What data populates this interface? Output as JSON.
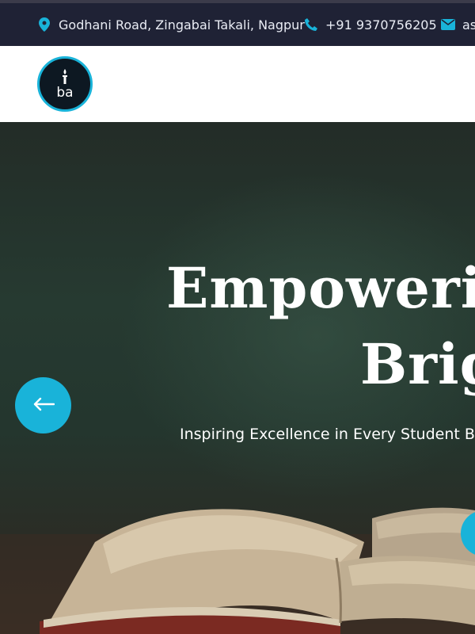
{
  "topbar": {
    "address": "Godhani Road, Zingabai Takali, Nagpur",
    "phone": "+91 9370756205",
    "email_partial": "as",
    "icons": {
      "address": "map-marker-icon",
      "phone": "phone-icon",
      "email": "envelope-icon"
    }
  },
  "header": {
    "logo_text": "ba",
    "logo_icon": "torch-icon"
  },
  "hero": {
    "title_line1": "Empowerin",
    "title_line2": "Brig",
    "subtitle": "Inspiring Excellence in Every Student Bu",
    "prev_icon": "arrow-left-icon"
  },
  "colors": {
    "accent": "#19b3d9",
    "topbar_bg": "#1f2235",
    "logo_bg": "#0d1822"
  }
}
